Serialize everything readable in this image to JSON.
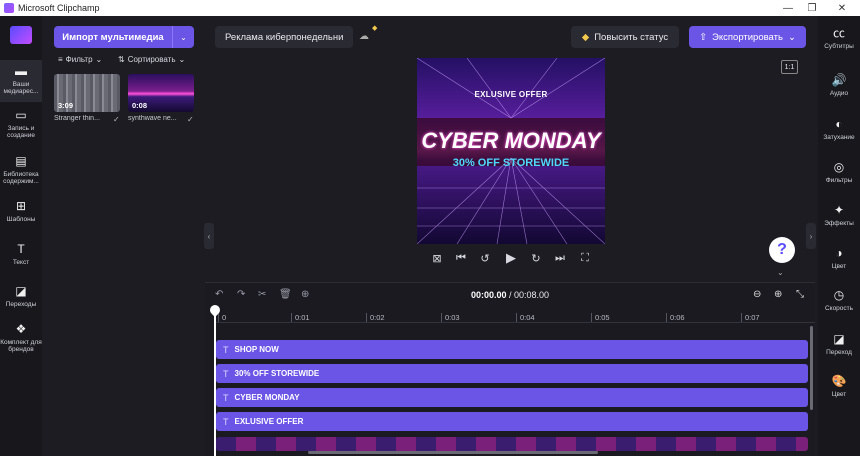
{
  "window": {
    "title": "Microsoft Clipchamp",
    "controls": [
      "—",
      "❐",
      "✕"
    ]
  },
  "leftnav": {
    "items": [
      {
        "label": "Ваши медиарес...",
        "icon": "folder-icon"
      },
      {
        "label": "Запись и создание",
        "icon": "camera-icon"
      },
      {
        "label": "Библиотека содержим...",
        "icon": "library-icon"
      },
      {
        "label": "Шаблоны",
        "icon": "templates-icon"
      },
      {
        "label": "Текст",
        "icon": "text-icon"
      },
      {
        "label": "Переходы",
        "icon": "transitions-icon"
      },
      {
        "label": "Комплект для брендов",
        "icon": "brand-kit-icon"
      }
    ]
  },
  "media": {
    "import_label": "Импорт мультимедиа",
    "filter_label": "Фильтр",
    "sort_label": "Сортировать",
    "items": [
      {
        "name": "Stranger thin...",
        "duration": "3:09"
      },
      {
        "name": "synthwave ne...",
        "duration": "0:08"
      }
    ]
  },
  "topbar": {
    "project_name": "Реклама киберпонедельни",
    "upgrade_label": "Повысить статус",
    "export_label": "Экспортировать"
  },
  "preview": {
    "line1": "EXLUSIVE OFFER",
    "line2": "CYBER MONDAY",
    "line3": "30% OFF STOREWIDE",
    "aspect": "1:1"
  },
  "rightnav": {
    "items": [
      {
        "label": "Субтитры",
        "icon": "captions-icon"
      },
      {
        "label": "Аудио",
        "icon": "audio-icon"
      },
      {
        "label": "Затухание",
        "icon": "fade-icon"
      },
      {
        "label": "Фильтры",
        "icon": "filters-icon"
      },
      {
        "label": "Эффекты",
        "icon": "effects-icon"
      },
      {
        "label": "Цвет",
        "icon": "color-icon"
      },
      {
        "label": "Скорость",
        "icon": "speed-icon"
      },
      {
        "label": "Переход",
        "icon": "transition-icon"
      },
      {
        "label": "Цвет",
        "icon": "color-palette-icon"
      }
    ]
  },
  "timeline": {
    "current": "00:00.00",
    "total": "00:08.00",
    "ticks": [
      "0",
      "0:01",
      "0:02",
      "0:03",
      "0:04",
      "0:05",
      "0:06",
      "0:07"
    ],
    "tracks": [
      "SHOP NOW",
      "30% OFF STOREWIDE",
      "CYBER MONDAY",
      "EXLUSIVE OFFER"
    ]
  },
  "colors": {
    "accent": "#6b55e6",
    "background": "#1c1c22"
  }
}
